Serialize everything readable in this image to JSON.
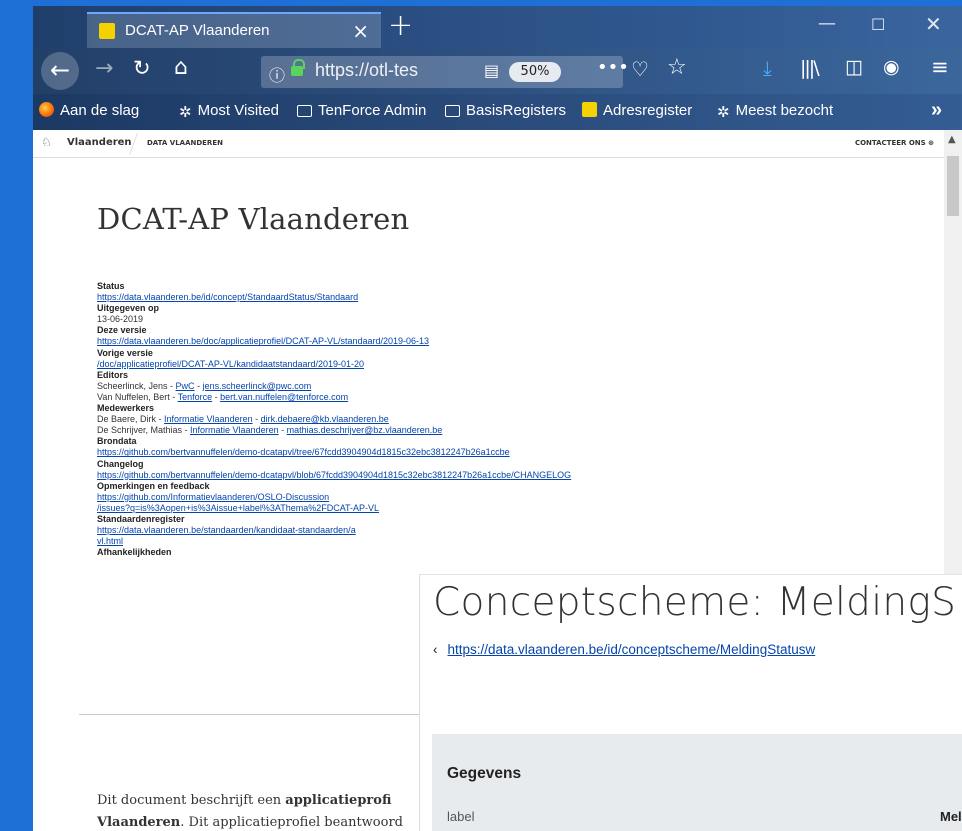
{
  "browser": {
    "tab_title": "DCAT-AP Vlaanderen",
    "url": "https://otl-tes",
    "zoom": "50%",
    "bookmarks": [
      "Aan de slag",
      "Most Visited",
      "TenForce Admin",
      "BasisRegisters",
      "Adresregister",
      "Meest bezocht"
    ]
  },
  "site_header": {
    "brand": "Vlaanderen",
    "section": "DATA VLAANDEREN",
    "contact": "CONTACTEER ONS"
  },
  "doc": {
    "title": "DCAT-AP Vlaanderen",
    "status_label": "Status",
    "status_value": "https://data.vlaanderen.be/id/concept/StandaardStatus/Standaard",
    "issued_label": "Uitgegeven op",
    "issued_value": "13-06-2019",
    "this_version_label": "Deze versie",
    "this_version_value": "https://data.vlaanderen.be/doc/applicatieprofiel/DCAT-AP-VL/standaard/2019-06-13",
    "prev_version_label": "Vorige versie",
    "prev_version_value": "/doc/applicatieprofiel/DCAT-AP-VL/kandidaatstandaard/2019-01-20",
    "editors_label": "Editors",
    "editors": [
      {
        "name": "Scheerlinck, Jens",
        "org": "PwC",
        "email": "jens.scheerlinck@pwc.com"
      },
      {
        "name": "Van Nuffelen, Bert",
        "org": "Tenforce",
        "email": "bert.van.nuffelen@tenforce.com"
      }
    ],
    "contributors_label": "Medewerkers",
    "contributors": [
      {
        "name": "De Baere, Dirk",
        "org": "Informatie Vlaanderen",
        "email": "dirk.debaere@kb.vlaanderen.be"
      },
      {
        "name": "De Schrijver, Mathias",
        "org": "Informatie Vlaanderen",
        "email": "mathias.deschrijver@bz.vlaanderen.be"
      }
    ],
    "source_label": "Brondata",
    "source_value": "https://github.com/bertvannuffelen/demo-dcatapvl/tree/67fcdd3904904d1815c32ebc3812247b26a1ccbe",
    "changelog_label": "Changelog",
    "changelog_value": "https://github.com/bertvannuffelen/demo-dcatapvl/blob/67fcdd3904904d1815c32ebc3812247b26a1ccbe/CHANGELOG",
    "feedback_label": "Opmerkingen en feedback",
    "feedback_value_1": "https://github.com/Informatievlaanderen/OSLO-Discussion",
    "feedback_value_2": "/issues?q=is%3Aopen+is%3Aissue+label%3AThema%2FDCAT-AP-VL",
    "register_label": "Standaardenregister",
    "register_value_1": "https://data.vlaanderen.be/standaarden/kandidaat-standaarden/a",
    "register_value_2": "vl.html",
    "deps_label": "Afhankelijkheden",
    "intro_1a": "Dit document beschrijft een ",
    "intro_1b": "applicatieprofi",
    "intro_2a": "Vlaanderen",
    "intro_2b": ". Dit applicatieprofiel beantwoord"
  },
  "overlay": {
    "title": "Conceptscheme: MeldingS",
    "link": "https://data.vlaanderen.be/id/conceptscheme/MeldingStatusw",
    "panel_heading": "Gegevens",
    "row_label": "label",
    "row_value": "Mel"
  }
}
